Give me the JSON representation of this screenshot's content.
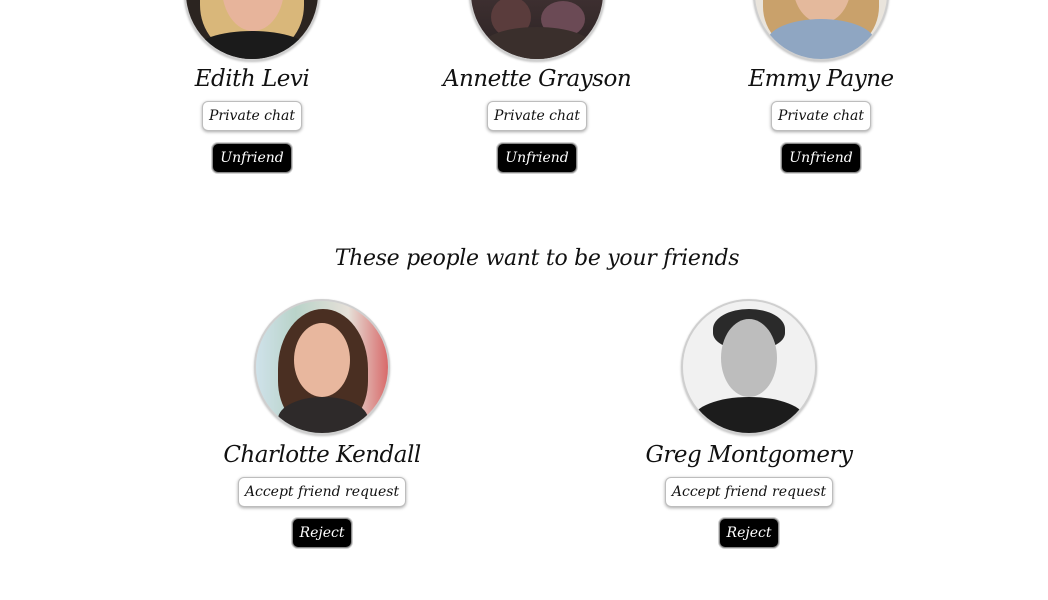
{
  "friends": [
    {
      "name": "Edith Levi",
      "chat_label": "Private chat",
      "unfriend_label": "Unfriend"
    },
    {
      "name": "Annette Grayson",
      "chat_label": "Private chat",
      "unfriend_label": "Unfriend"
    },
    {
      "name": "Emmy Payne",
      "chat_label": "Private chat",
      "unfriend_label": "Unfriend"
    }
  ],
  "requests": {
    "title": "These people want to be your friends",
    "items": [
      {
        "name": "Charlotte Kendall",
        "accept_label": "Accept friend request",
        "reject_label": "Reject"
      },
      {
        "name": "Greg Montgomery",
        "accept_label": "Accept friend request",
        "reject_label": "Reject"
      }
    ]
  }
}
